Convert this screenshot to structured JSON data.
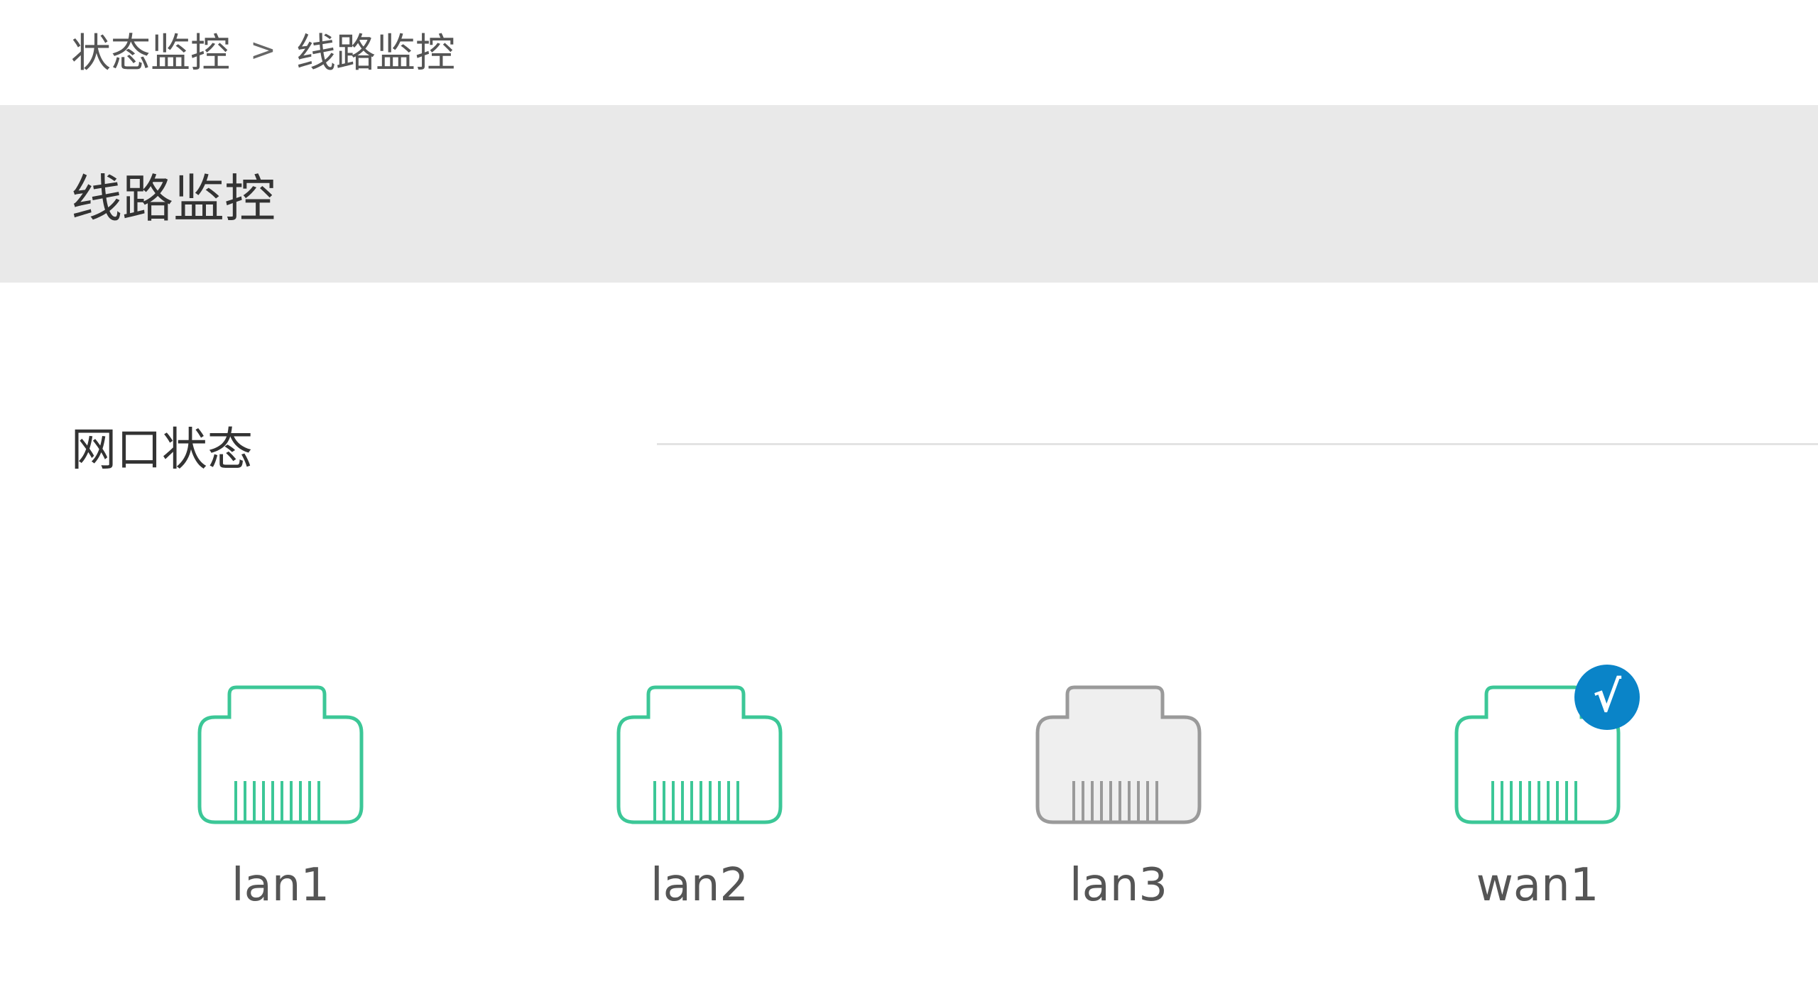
{
  "breadcrumb": {
    "parent": "状态监控",
    "separator": ">",
    "current": "线路监控"
  },
  "page_title": "线路监控",
  "section": {
    "title": "网口状态"
  },
  "ports": [
    {
      "label": "lan1",
      "state": "connected",
      "active": false
    },
    {
      "label": "lan2",
      "state": "connected",
      "active": false
    },
    {
      "label": "lan3",
      "state": "disconnected",
      "active": false
    },
    {
      "label": "wan1",
      "state": "connected",
      "active": true,
      "badge": "√"
    }
  ],
  "colors": {
    "connected_stroke": "#3cc797",
    "connected_fill": "#ffffff",
    "disconnected_stroke": "#9a9a9a",
    "disconnected_fill": "#efefef",
    "badge": "#0a84c8",
    "title_bar": "#e9e9e9"
  }
}
